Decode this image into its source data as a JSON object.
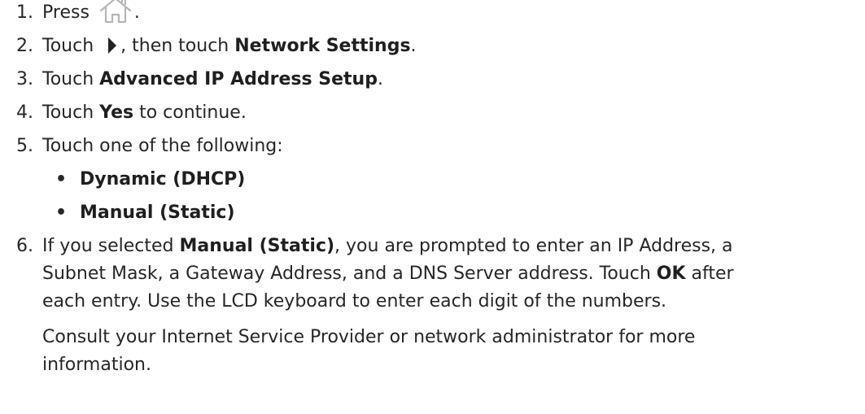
{
  "steps": [
    {
      "num": "1.",
      "pre": "Press",
      "post": "."
    },
    {
      "num": "2.",
      "pre": "Touch",
      "mid": ", then touch",
      "bold": "Network Settings",
      "post": "."
    },
    {
      "num": "3.",
      "pre": "Touch",
      "bold": "Advanced IP Address Setup",
      "post": "."
    },
    {
      "num": "4.",
      "pre": "Touch",
      "bold": "Yes",
      "post": "to continue."
    },
    {
      "num": "5.",
      "text": "Touch one of the following:"
    },
    {
      "num": "6.",
      "pre": "If you selected",
      "bold": "Manual (Static)",
      "post": ", you are prompted to enter an IP Address, a",
      "line2": "Subnet Mask, a Gateway Address, and a DNS Server address. Touch",
      "line2_bold": "OK",
      "line2_post": "after",
      "line3": "each entry. Use the LCD keyboard to enter each digit of the numbers."
    }
  ],
  "options": [
    "Dynamic (DHCP)",
    "Manual (Static)"
  ],
  "bullet_char": "•",
  "note_line1": "Consult your Internet Service Provider or network administrator for more",
  "note_line2": "information.",
  "icons": {
    "home": "home-icon",
    "arrow": "right-arrow-icon"
  },
  "colors": {
    "text": "#262626",
    "icon_stroke": "#b5b5b5",
    "arrow": "#222222"
  }
}
